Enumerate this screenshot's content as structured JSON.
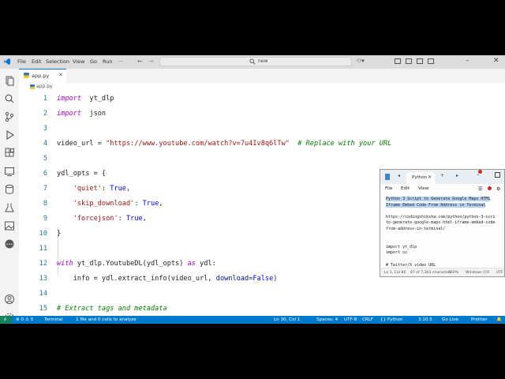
{
  "window": {
    "menu": [
      "File",
      "Edit",
      "Selection",
      "View",
      "Go",
      "Run"
    ],
    "command_center": {
      "value": "new"
    }
  },
  "tab": {
    "label": "app.py"
  },
  "breadcrumb": {
    "label": "app.py"
  },
  "editor": {
    "lines": [
      {
        "n": "1",
        "segs": [
          [
            "kw",
            "import"
          ],
          [
            "",
            "  yt_dlp"
          ]
        ]
      },
      {
        "n": "2",
        "segs": [
          [
            "kw",
            "import"
          ],
          [
            "",
            "  json"
          ]
        ]
      },
      {
        "n": "3",
        "segs": []
      },
      {
        "n": "4",
        "segs": [
          [
            "",
            "video_url = "
          ],
          [
            "str",
            "\"https://www.youtube.com/watch?v=7u4Iv8q6lTw\""
          ],
          [
            "cm",
            "  # Replace with your URL"
          ]
        ]
      },
      {
        "n": "5",
        "segs": []
      },
      {
        "n": "6",
        "segs": [
          [
            "",
            "ydl_opts = {"
          ]
        ]
      },
      {
        "n": "7",
        "segs": [
          [
            "",
            "    "
          ],
          [
            "str",
            "'quiet'"
          ],
          [
            "",
            ": "
          ],
          [
            "num",
            "True"
          ],
          [
            "",
            ","
          ]
        ]
      },
      {
        "n": "8",
        "segs": [
          [
            "",
            "    "
          ],
          [
            "str",
            "'skip_download'"
          ],
          [
            "",
            ": "
          ],
          [
            "num",
            "True"
          ],
          [
            "",
            ","
          ]
        ]
      },
      {
        "n": "9",
        "segs": [
          [
            "",
            "    "
          ],
          [
            "str",
            "'forcejson'"
          ],
          [
            "",
            ": "
          ],
          [
            "num",
            "True"
          ],
          [
            "",
            ","
          ]
        ]
      },
      {
        "n": "10",
        "segs": [
          [
            "",
            "}"
          ]
        ]
      },
      {
        "n": "11",
        "segs": []
      },
      {
        "n": "12",
        "segs": [
          [
            "kw",
            "with"
          ],
          [
            "",
            " yt_dlp.YoutubeDL(ydl_opts) "
          ],
          [
            "kw",
            "as"
          ],
          [
            "",
            " ydl:"
          ]
        ]
      },
      {
        "n": "13",
        "segs": [
          [
            "",
            "    info = ydl.extract_info(video_url, "
          ],
          [
            "prm",
            "download"
          ],
          [
            "",
            "="
          ],
          [
            "num",
            "False"
          ],
          [
            "",
            ")"
          ]
        ]
      },
      {
        "n": "14",
        "segs": []
      },
      {
        "n": "15",
        "segs": [
          [
            "cm",
            "# Extract tags and metadata"
          ]
        ]
      }
    ]
  },
  "status_bar": {
    "left": [
      "⊗ 0  ⚠ 0",
      "Terminal",
      "1 file and 0 cells to analyze"
    ],
    "right": [
      "Ln 30, Col 1",
      "Spaces: 4",
      "UTF-8",
      "CRLF",
      "{} Python",
      "3.10.5",
      "Go Live",
      "Prettier"
    ]
  },
  "notepad": {
    "tab_label": "Python",
    "menu": [
      "File",
      "Edit",
      "View"
    ],
    "lines": [
      {
        "text": "Python 3 Script to Generate Google Maps HTML",
        "selected": true
      },
      {
        "text": "Iframe Embed Code From Address in Terminal",
        "selected": true
      },
      {
        "text": "",
        "selected": false
      },
      {
        "text": "https://codingshiksha.com/python/python-3-scri",
        "selected": false
      },
      {
        "text": "to-generate-google-maps-html-iframe-embed-code",
        "selected": false
      },
      {
        "text": "from-address-in-terminal/",
        "selected": false
      },
      {
        "text": "",
        "selected": false
      },
      {
        "text": "",
        "selected": false
      },
      {
        "text": "import yt_dlp",
        "selected": false
      },
      {
        "text": "import os",
        "selected": false
      },
      {
        "text": "",
        "selected": false
      },
      {
        "text": "# Twitter/X video URL",
        "selected": false
      }
    ],
    "status": [
      "Ln 1, Col 80",
      "87 of 7,363 characters",
      "100%",
      "Windows (CR",
      "UTF"
    ]
  },
  "colors": {
    "accent": "#007acc",
    "keyword": "#af00db",
    "string": "#a31515",
    "comment": "#008000"
  }
}
